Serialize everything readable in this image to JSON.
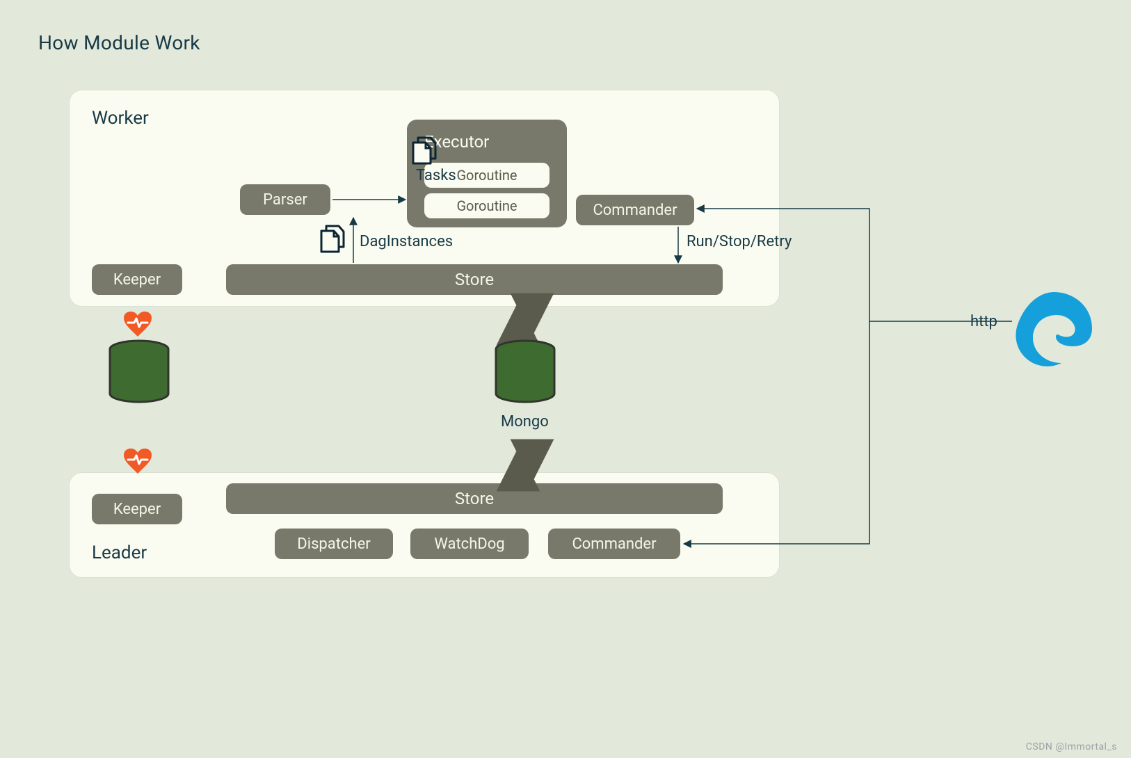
{
  "title": "How Module Work",
  "worker": {
    "title": "Worker",
    "keeper": "Keeper",
    "parser": "Parser",
    "store": "Store",
    "commander": "Commander",
    "executor": {
      "title": "Executor",
      "items": [
        "Goroutine",
        "Goroutine"
      ]
    }
  },
  "leader": {
    "title": "Leader",
    "keeper": "Keeper",
    "store": "Store",
    "dispatcher": "Dispatcher",
    "watchdog": "WatchDog",
    "commander": "Commander"
  },
  "labels": {
    "tasks": "Tasks",
    "daginstances": "DagInstances",
    "runstopretry": "Run/Stop/Retry",
    "mongo": "Mongo",
    "http": "http"
  },
  "icons": {
    "heart": "heart-pulse-icon",
    "db": "database-icon",
    "files": "files-icon",
    "edge": "edge-browser-icon"
  },
  "watermark": "CSDN @Immortal_s"
}
